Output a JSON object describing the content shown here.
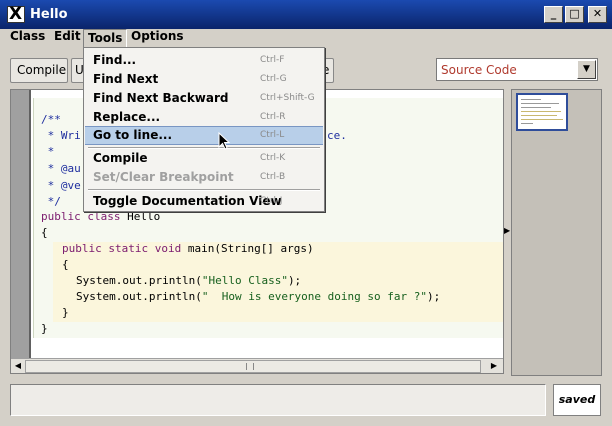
{
  "window": {
    "title": "Hello",
    "minimize_glyph": "_",
    "maximize_glyph": "□",
    "close_glyph": "✕",
    "icon": "java-x-icon"
  },
  "menubar": [
    "Class",
    "Edit",
    "Tools",
    "Options"
  ],
  "toolbar": {
    "compile_label": "Compile",
    "second_label": "U",
    "partial_label": "e"
  },
  "view_select": {
    "value": "Source Code",
    "arrow": "▼"
  },
  "tools_menu": [
    {
      "label": "Find...",
      "accel": "Ctrl-F",
      "enabled": true
    },
    {
      "label": "Find Next",
      "accel": "Ctrl-G",
      "enabled": true
    },
    {
      "label": "Find Next Backward",
      "accel": "Ctrl+Shift-G",
      "enabled": true
    },
    {
      "label": "Replace...",
      "accel": "Ctrl-R",
      "enabled": true
    },
    {
      "label": "Go to line...",
      "accel": "Ctrl-L",
      "enabled": true,
      "selected": true
    },
    {
      "label": "Compile",
      "accel": "Ctrl-K",
      "enabled": true
    },
    {
      "label": "Set/Clear Breakpoint",
      "accel": "Ctrl-B",
      "enabled": false
    },
    {
      "label": "Toggle Documentation View",
      "accel": "Ctrl-J",
      "enabled": true
    }
  ],
  "code": {
    "l1": "/**",
    "l2a": " * Wri",
    "l2b": "ce.",
    "l3": " *",
    "l4": " * @au",
    "l5": " * @ve",
    "l6": " */",
    "l7_kw": "public class",
    "l7_rest": " Hello",
    "l8": "{",
    "l9_kw": "public static void",
    "l9_rest": " main(String[] args)",
    "l10": "{",
    "l11_pre": "System.out.println(",
    "l11_str": "\"Hello Class\"",
    "l11_post": ");",
    "l12_pre": "System.out.println(",
    "l12_str": "\"  How is everyone doing so far ?\"",
    "l12_post": ");",
    "l13": "}",
    "l14": "}"
  },
  "status": {
    "message": "",
    "saved": "saved"
  },
  "scroll": {
    "left": "◀",
    "right": "▶",
    "split": "▶"
  }
}
